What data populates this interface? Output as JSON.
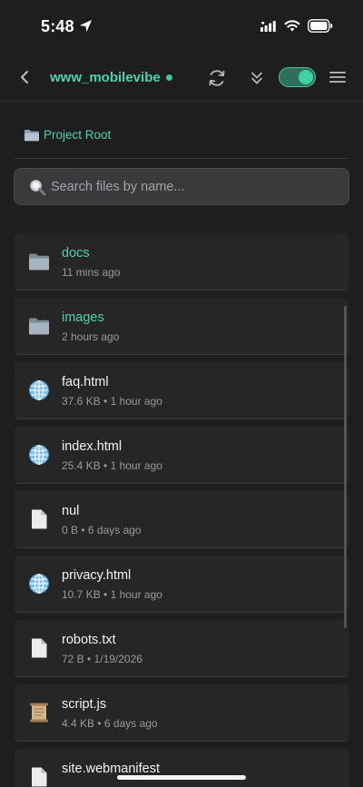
{
  "status": {
    "time": "5:48"
  },
  "nav": {
    "title": "www_mobilevibe"
  },
  "breadcrumb": {
    "label": "Project Root"
  },
  "search": {
    "placeholder": "Search files by name..."
  },
  "files": [
    {
      "name": "docs",
      "meta": "11 mins ago",
      "type": "folder"
    },
    {
      "name": "images",
      "meta": "2 hours ago",
      "type": "folder"
    },
    {
      "name": "faq.html",
      "meta": "37.6 KB • 1 hour ago",
      "type": "html"
    },
    {
      "name": "index.html",
      "meta": "25.4 KB • 1 hour ago",
      "type": "html"
    },
    {
      "name": "nul",
      "meta": "0 B • 6 days ago",
      "type": "file"
    },
    {
      "name": "privacy.html",
      "meta": "10.7 KB • 1 hour ago",
      "type": "html"
    },
    {
      "name": "robots.txt",
      "meta": "72 B • 1/19/2026",
      "type": "file"
    },
    {
      "name": "script.js",
      "meta": "4.4 KB • 6 days ago",
      "type": "script"
    },
    {
      "name": "site.webmanifest",
      "meta": "",
      "type": "file"
    }
  ],
  "colors": {
    "accent": "#4fd1b0",
    "background": "#1e1e1e",
    "row": "#262626"
  }
}
